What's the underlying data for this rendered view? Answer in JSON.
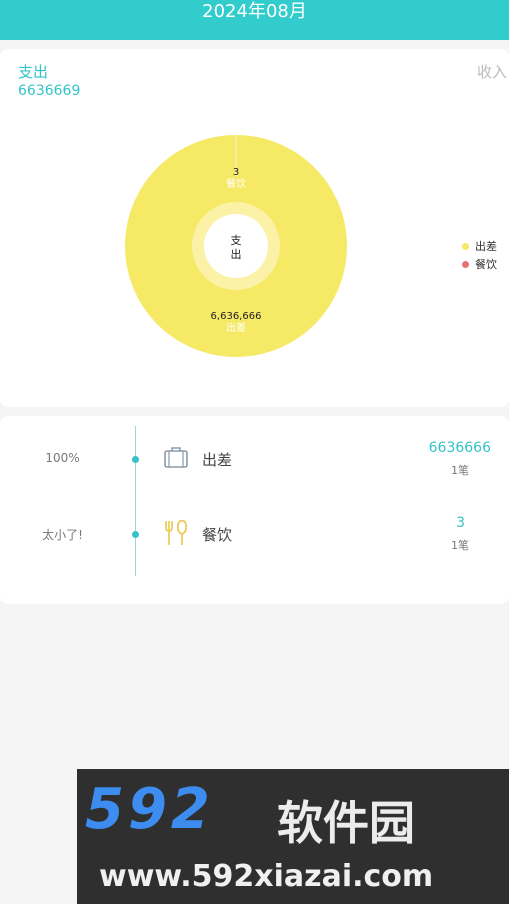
{
  "header": {
    "title": "2024年08月"
  },
  "summary": {
    "expense_tab": "支出",
    "income_tab": "收入",
    "expense_total": "6636669"
  },
  "chart_data": {
    "type": "pie",
    "center_label": "支\n出",
    "slices": [
      {
        "label": "出差",
        "value": 6636666,
        "value_label": "6,636,666",
        "color": "#f5e965"
      },
      {
        "label": "餐饮",
        "value": 3,
        "value_label": "3",
        "color": "#e57373"
      }
    ],
    "legend": {
      "placement": "right",
      "items": [
        "出差",
        "餐饮"
      ]
    }
  },
  "list": {
    "rows": [
      {
        "percent": "100%",
        "icon": "suitcase-icon",
        "name": "出差",
        "amount": "6636666",
        "count": "1笔"
      },
      {
        "percent": "太小了!",
        "icon": "utensils-icon",
        "name": "餐饮",
        "amount": "3",
        "count": "1笔"
      }
    ]
  },
  "watermark": {
    "logo": "592",
    "cn": "软件园",
    "url": "www.592xiazai.com"
  }
}
